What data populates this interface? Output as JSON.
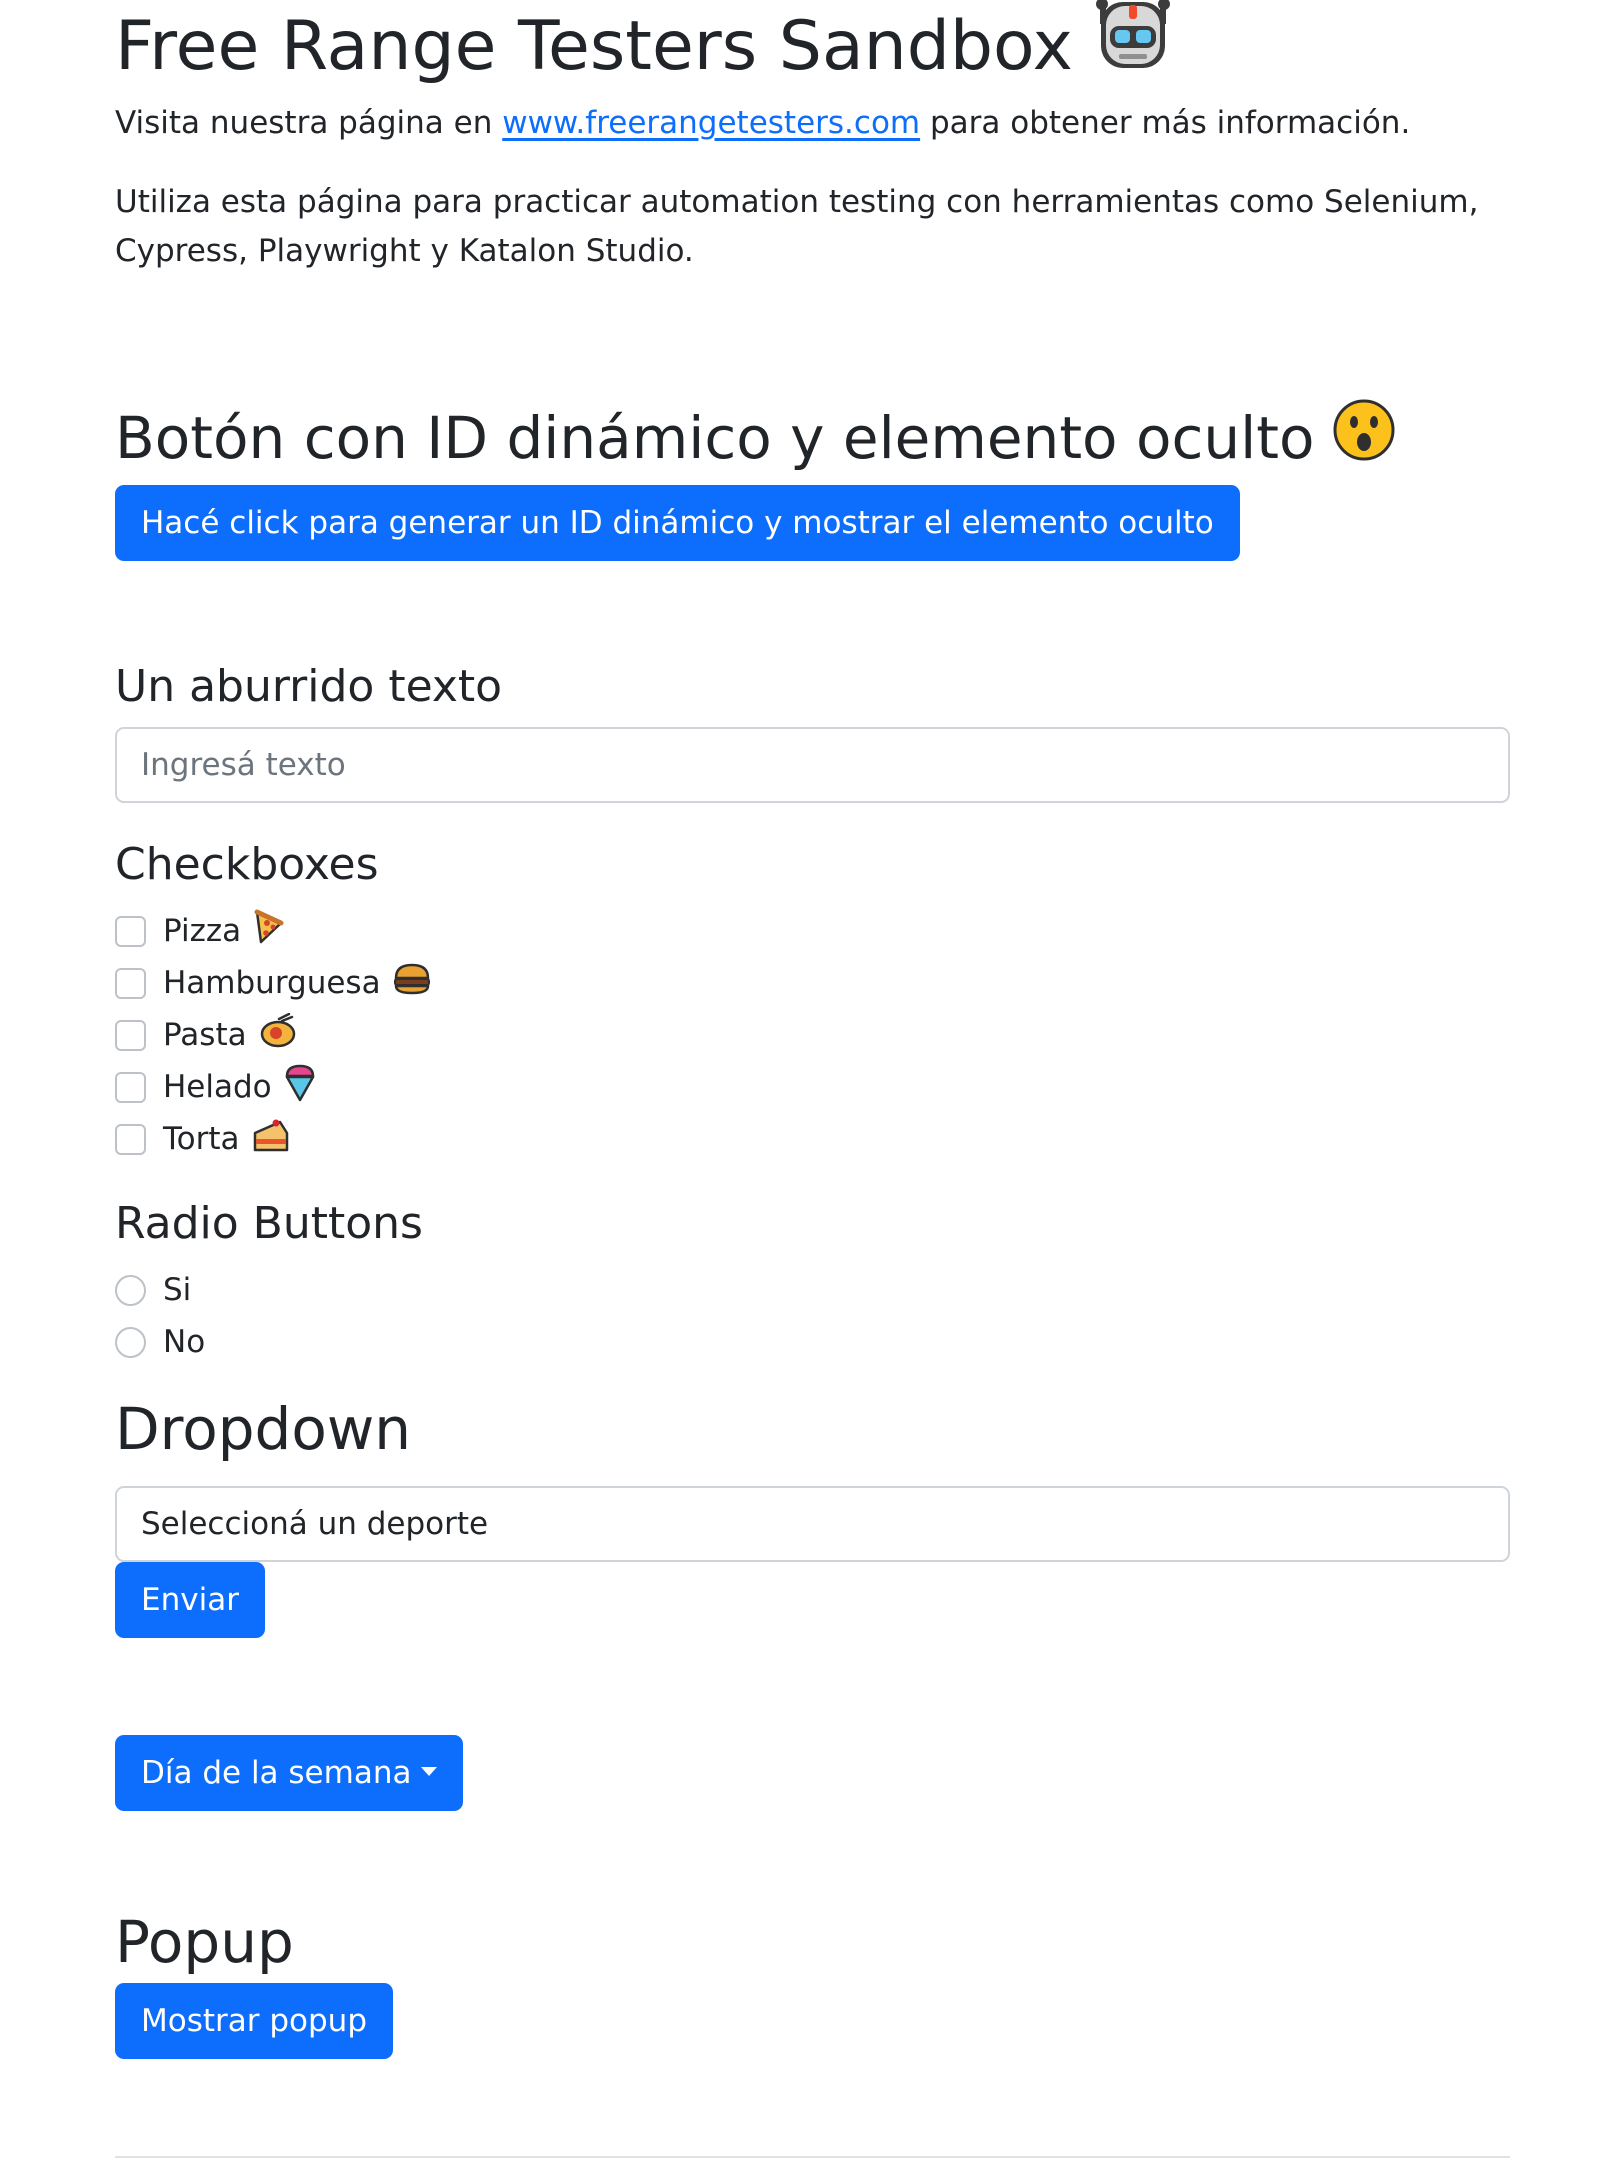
{
  "header": {
    "title": "Free Range Testers Sandbox",
    "intro_prefix": "Visita nuestra página en ",
    "intro_link": "www.freerangetesters.com",
    "intro_suffix": " para obtener más información.",
    "description": "Utiliza esta página para practicar automation testing con herramientas como Selenium, Cypress, Playwright y Katalon Studio."
  },
  "dynamic_section": {
    "title": "Botón con ID dinámico y elemento oculto",
    "button_label": "Hacé click para generar un ID dinámico y mostrar el elemento oculto"
  },
  "text_section": {
    "title": "Un aburrido texto",
    "placeholder": "Ingresá texto",
    "value": ""
  },
  "checkbox_section": {
    "title": "Checkboxes",
    "items": [
      {
        "label": "Pizza",
        "icon": "pizza-icon",
        "checked": false
      },
      {
        "label": "Hamburguesa",
        "icon": "hamburger-icon",
        "checked": false
      },
      {
        "label": "Pasta",
        "icon": "pasta-icon",
        "checked": false
      },
      {
        "label": "Helado",
        "icon": "ice-cream-icon",
        "checked": false
      },
      {
        "label": "Torta",
        "icon": "cake-icon",
        "checked": false
      }
    ]
  },
  "radio_section": {
    "title": "Radio Buttons",
    "items": [
      {
        "label": "Si",
        "selected": false
      },
      {
        "label": "No",
        "selected": false
      }
    ]
  },
  "dropdown_section": {
    "title": "Dropdown",
    "selected": "Seleccioná un deporte",
    "submit_label": "Enviar"
  },
  "weekday_dropdown": {
    "label": "Día de la semana"
  },
  "popup_section": {
    "title": "Popup",
    "button_label": "Mostrar popup"
  },
  "colors": {
    "primary": "#0d6efd",
    "text": "#212529",
    "border": "#ced4da",
    "placeholder": "#6c757d"
  }
}
